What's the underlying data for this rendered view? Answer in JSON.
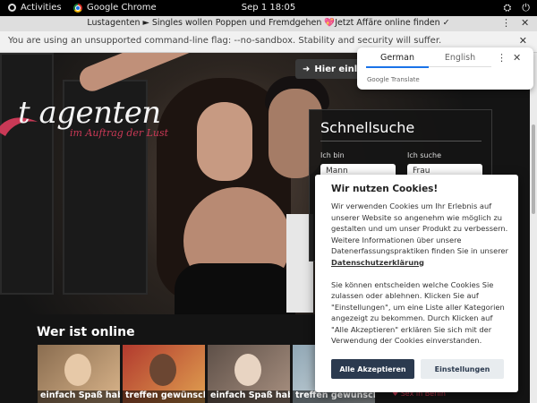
{
  "os": {
    "activities": "Activities",
    "app_name": "Google Chrome",
    "clock": "Sep 1  18:05",
    "tray": [
      "⛭",
      "⏻"
    ]
  },
  "window": {
    "title": "Lustagenten ► Singles wollen Poppen und Fremdgehen 💖Jetzt Affäre online finden ✓",
    "menu_icon": "⋮",
    "close_icon": "✕"
  },
  "infobar": {
    "message": "You are using an unsupported command-line flag: --no-sandbox. Stability and security will suffer.",
    "close_icon": "✕"
  },
  "translate": {
    "tab_active": "German",
    "tab_inactive": "English",
    "more_icon": "⋮",
    "close_icon": "✕",
    "brand": "Google Translate"
  },
  "site": {
    "logo_text": "t agenten",
    "logo_sub": "im Auftrag der Lust",
    "login_label": "Hier einlog",
    "login_icon": "➜"
  },
  "search": {
    "title": "Schnellsuche",
    "i_am_label": "Ich bin",
    "i_am_value": "Mann",
    "looking_label": "Ich suche",
    "looking_value": "Frau"
  },
  "online": {
    "title": "Wer ist online",
    "profiles": [
      {
        "caption": "einfach Spaß haben"
      },
      {
        "caption": "treffen gewünscht"
      },
      {
        "caption": "einfach Spaß haben"
      },
      {
        "caption": "treffen gewünscht"
      }
    ],
    "side_link": "♥ Sex in Berlin"
  },
  "cookie": {
    "title": "Wir nutzen Cookies!",
    "text1": "Wir verwenden Cookies um Ihr Erlebnis auf unserer Website so angenehm wie möglich zu gestalten und um unser Produkt zu verbessern. Weitere Informationen über unsere Datenerfassungspraktiken finden Sie in unserer ",
    "link": "Datenschutzerklärung",
    "text2": "Sie können entscheiden welche Cookies Sie zulassen oder ablehnen. Klicken Sie auf \"Einstellungen\", um eine Liste aller Kategorien angezeigt zu bekommen. Durch Klicken auf \"Alle Akzeptieren\" erklären Sie sich mit der Verwendung der Cookies einverstanden.",
    "accept": "Alle Akzeptieren",
    "settings": "Einstellungen"
  },
  "colors": {
    "brand_red": "#c93956",
    "dialog_button": "#2b3a4f",
    "translate_accent": "#1a73e8"
  }
}
